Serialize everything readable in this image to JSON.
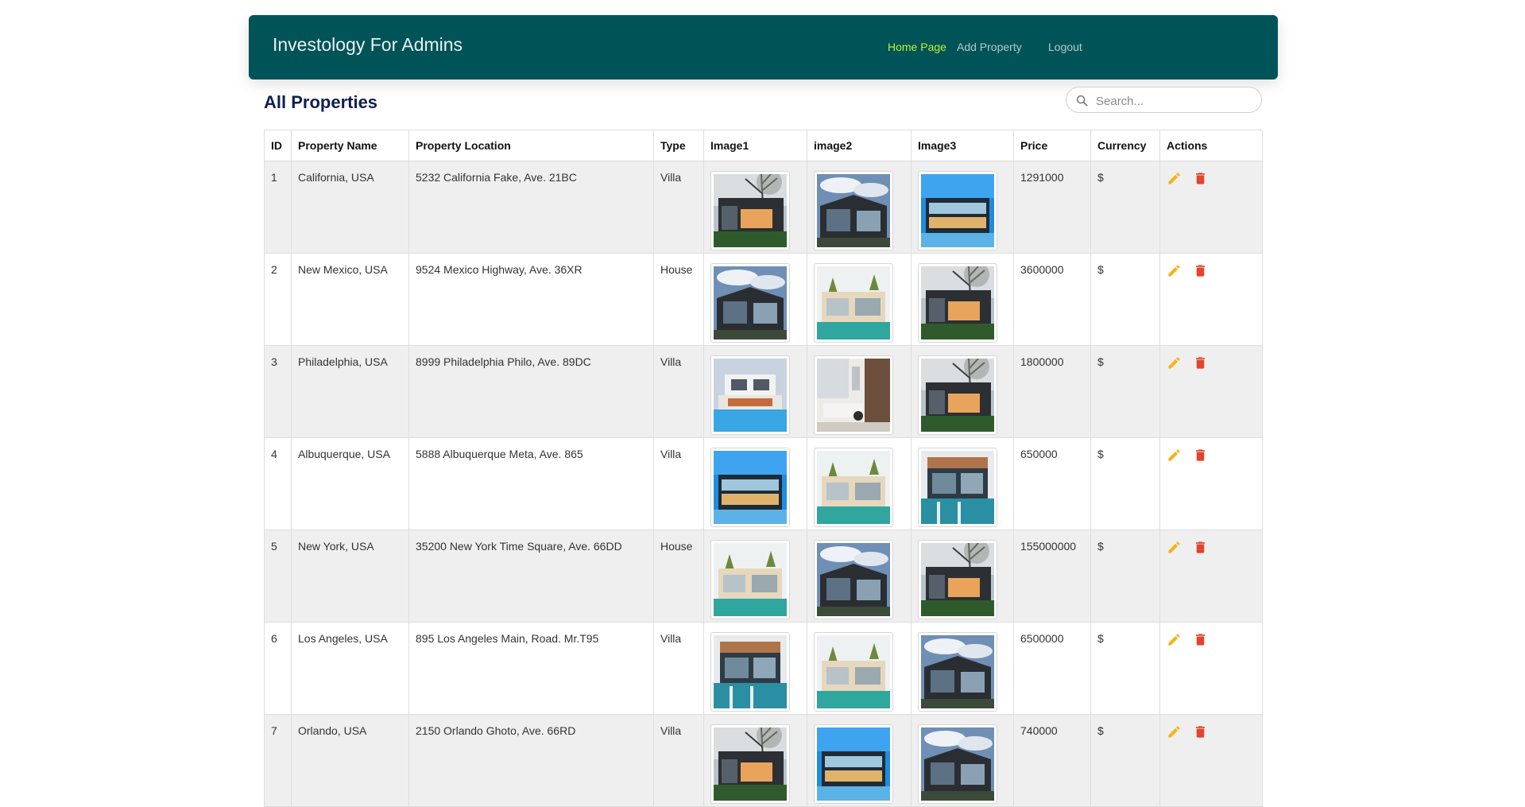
{
  "nav": {
    "brand": "Investology For Admins",
    "links": [
      {
        "label": "Home Page",
        "active": true
      },
      {
        "label": "Add Property",
        "active": false
      },
      {
        "label": "Logout",
        "active": false
      }
    ]
  },
  "page_title": "All Properties",
  "search": {
    "placeholder": "Search...",
    "value": ""
  },
  "table": {
    "headers": [
      "ID",
      "Property Name",
      "Property Location",
      "Type",
      "Image1",
      "image2",
      "Image3",
      "Price",
      "Currency",
      "Actions"
    ],
    "rows": [
      {
        "id": "1",
        "name": "California, USA",
        "location": "5232 California Fake, Ave. 21BC",
        "type": "Villa",
        "images": [
          "tree-house",
          "sky-house",
          "blue-glass-house"
        ],
        "price": "1291000",
        "currency": "$"
      },
      {
        "id": "2",
        "name": "New Mexico, USA",
        "location": "9524 Mexico Highway, Ave. 36XR",
        "type": "House",
        "images": [
          "sky-house",
          "pool-villa",
          "tree-house"
        ],
        "price": "3600000",
        "currency": "$"
      },
      {
        "id": "3",
        "name": "Philadelphia, USA",
        "location": "8999 Philadelphia Philo, Ave. 89DC",
        "type": "Villa",
        "images": [
          "white-pool-house",
          "interior-living",
          "tree-house"
        ],
        "price": "1800000",
        "currency": "$"
      },
      {
        "id": "4",
        "name": "Albuquerque, USA",
        "location": "5888 Albuquerque Meta, Ave. 865",
        "type": "Villa",
        "images": [
          "blue-glass-house",
          "pool-villa",
          "modern-pool-house"
        ],
        "price": "650000",
        "currency": "$"
      },
      {
        "id": "5",
        "name": "New York, USA",
        "location": "35200 New York Time Square, Ave. 66DD",
        "type": "House",
        "images": [
          "pool-villa",
          "sky-house",
          "tree-house"
        ],
        "price": "155000000",
        "currency": "$"
      },
      {
        "id": "6",
        "name": "Los Angeles, USA",
        "location": "895 Los Angeles Main, Road. Mr.T95",
        "type": "Villa",
        "images": [
          "modern-pool-house",
          "pool-villa",
          "sky-house"
        ],
        "price": "6500000",
        "currency": "$"
      },
      {
        "id": "7",
        "name": "Orlando, USA",
        "location": "2150 Orlando Ghoto, Ave. 66RD",
        "type": "Villa",
        "images": [
          "tree-house",
          "blue-glass-house",
          "sky-house"
        ],
        "price": "740000",
        "currency": "$"
      }
    ]
  },
  "colors": {
    "navbar_bg": "#005458",
    "active_link": "#c6f02c",
    "edit_icon": "#f4b41a",
    "delete_icon": "#e2452b",
    "title": "#0e1f4d"
  }
}
